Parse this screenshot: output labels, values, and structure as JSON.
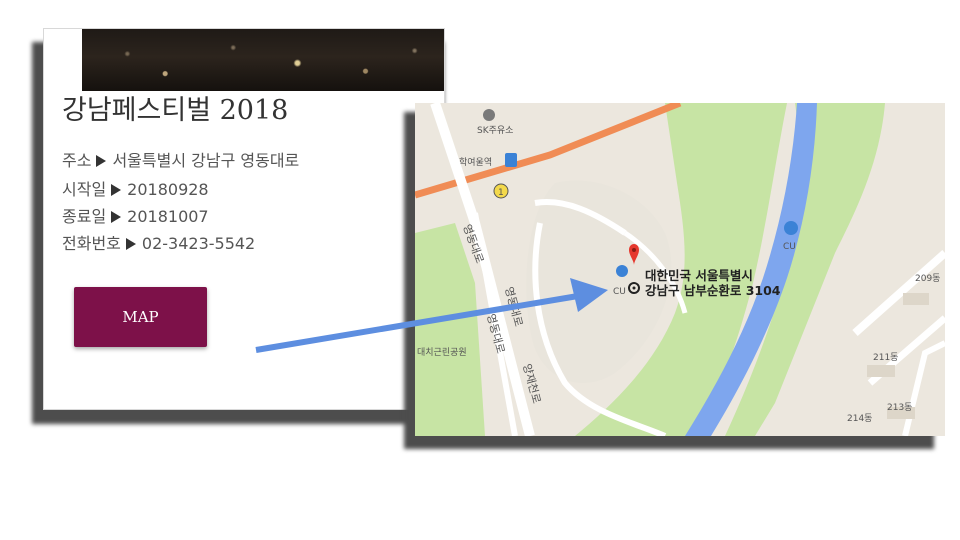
{
  "event": {
    "title": "강남페스티벌 2018",
    "rows": [
      {
        "label": "주소",
        "value": "서울특별시 강남구 영동대로"
      },
      {
        "label": "시작일",
        "value": "20180928"
      },
      {
        "label": "종료일",
        "value": "20181007"
      },
      {
        "label": "전화번호",
        "value": "02-3423-5542"
      }
    ],
    "map_button": "MAP"
  },
  "map": {
    "address_line1": "대한민국 서울특별시",
    "address_line2": "강남구 남부순환로 3104",
    "labels": {
      "gas_station": "SK주유소",
      "station": "학여울역",
      "exit": "1",
      "road_1": "영동대로",
      "road_2": "영동대로",
      "road_3": "영동대로",
      "road_4": "양재천로",
      "park": "대치근린공원",
      "store_1": "CU",
      "store_2": "CU",
      "bldg_209": "209동",
      "bldg_211": "211동",
      "bldg_213": "213동",
      "bldg_214": "214동"
    },
    "colors": {
      "river": "#7ea6ee",
      "park": "#bfe09a",
      "main_road": "#f08c55",
      "accent": "#7d1149",
      "arrow": "#5d8ee0",
      "pin": "#e5372d"
    }
  }
}
